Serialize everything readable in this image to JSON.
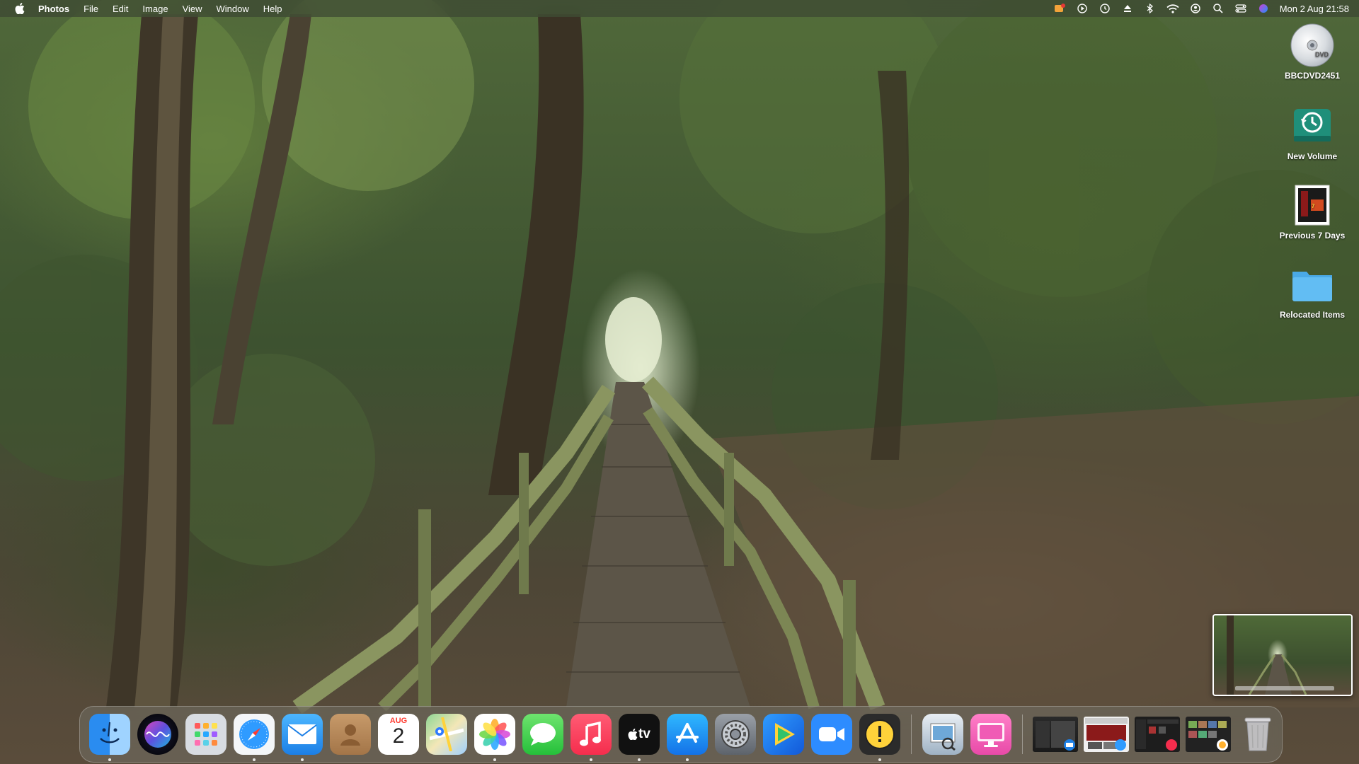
{
  "menubar": {
    "app_name": "Photos",
    "menus": [
      "File",
      "Edit",
      "Image",
      "View",
      "Window",
      "Help"
    ],
    "clock": "Mon 2 Aug  21:58"
  },
  "desktop_icons": [
    {
      "label": "BBCDVD2451",
      "icon": "dvd-icon"
    },
    {
      "label": "New Volume",
      "icon": "time-machine-drive-icon"
    },
    {
      "label": "Previous 7 Days",
      "icon": "screenshot-file-icon"
    },
    {
      "label": "Relocated Items",
      "icon": "folder-icon"
    }
  ],
  "dock": {
    "calendar_month": "AUG",
    "calendar_day": "2",
    "appletv_label": "tv"
  },
  "colors": {
    "accent_blue": "#1e88e5",
    "menubar": "#3c4632"
  }
}
